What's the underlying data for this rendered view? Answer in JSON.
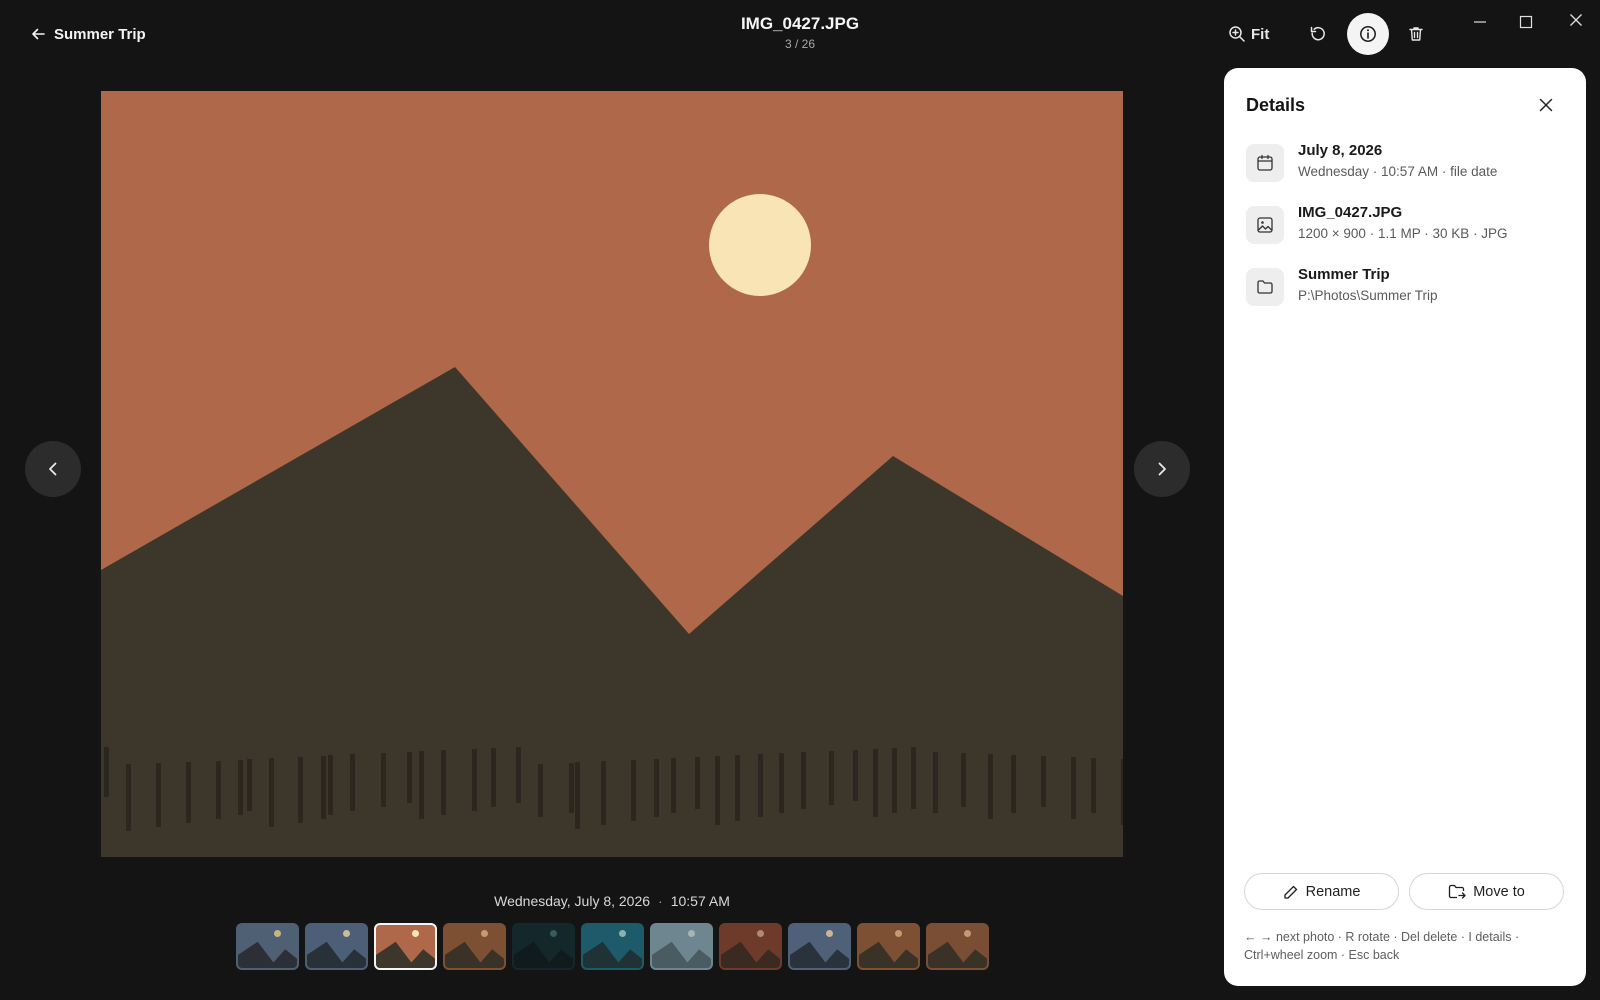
{
  "header": {
    "back_label": "Summer Trip",
    "title": "IMG_0427.JPG",
    "counter": "3 / 26",
    "fit_label": "Fit"
  },
  "photo": {
    "caption_date": "Wednesday, July 8, 2026",
    "caption_sep": "·",
    "caption_time": "10:57 AM",
    "colors": {
      "sky": "#b0684a",
      "mountain": "#3d362b",
      "sun": "#f8e4b4",
      "grass": "#2b261e"
    }
  },
  "filmstrip": {
    "selected_index": 2,
    "thumbs": [
      {
        "sky": "#4f5f74",
        "ground": "#2c3036",
        "sun": "#c9b28a"
      },
      {
        "sky": "#4c5f76",
        "ground": "#283038",
        "sun": "#cdbb96"
      },
      {
        "sky": "#b0684a",
        "ground": "#3d362b",
        "sun": "#f8e4b4"
      },
      {
        "sky": "#7e5033",
        "ground": "#3a3226",
        "sun": "#c79a72"
      },
      {
        "sky": "#14272b",
        "ground": "#111a1c",
        "sun": "#3a5a5e"
      },
      {
        "sky": "#1d5a6a",
        "ground": "#1f3337",
        "sun": "#8fb0b0"
      },
      {
        "sky": "#6e8690",
        "ground": "#4a5b61",
        "sun": "#a7b5b5"
      },
      {
        "sky": "#6e3a2a",
        "ground": "#3a2a22",
        "sun": "#b08a74"
      },
      {
        "sky": "#4f6178",
        "ground": "#2a323b",
        "sun": "#c7b69c"
      },
      {
        "sky": "#7e5033",
        "ground": "#3a3226",
        "sun": "#c79a72"
      },
      {
        "sky": "#7a4e34",
        "ground": "#3a3226",
        "sun": "#c59a76"
      }
    ]
  },
  "details": {
    "title": "Details",
    "date": {
      "main": "July 8, 2026",
      "sub": "Wednesday · 10:57 AM · file date"
    },
    "file": {
      "main": "IMG_0427.JPG",
      "sub": "1200 × 900 · 1.1 MP · 30 KB · JPG"
    },
    "folder": {
      "main": "Summer Trip",
      "sub": "P:\\Photos\\Summer Trip"
    },
    "rename_label": "Rename",
    "move_label": "Move to",
    "hints": "← → next photo · R rotate · Del delete · I details · Ctrl+wheel zoom · Esc back"
  }
}
